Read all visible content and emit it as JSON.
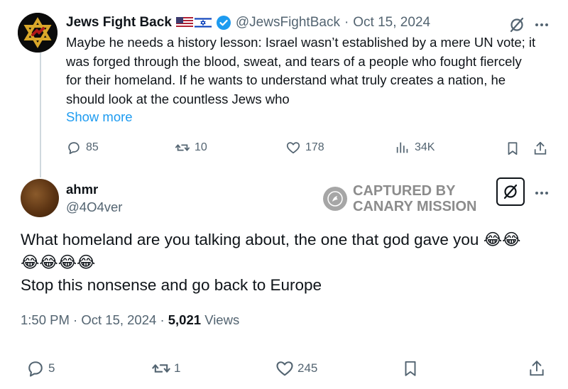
{
  "parent_tweet": {
    "author_name": "Jews Fight Back",
    "flags": [
      "flag-us-icon",
      "flag-israel-icon"
    ],
    "verified": "verified-badge-icon",
    "handle": "@JewsFightBack",
    "separator": "·",
    "date": "Oct 15, 2024",
    "body": "Maybe he needs a history lesson: Israel wasn’t established by a mere UN vote; it was forged through the blood, sweat, and tears of a people who fought fiercely for their homeland. If he wants to understand what truly creates a nation, he should look at the countless Jews who",
    "show_more": "Show more",
    "replies": "85",
    "reposts": "10",
    "likes": "178",
    "views": "34K"
  },
  "reply_tweet": {
    "author_name": "ahmr",
    "handle": "@4O4ver",
    "watermark_line1": "CAPTURED BY",
    "watermark_line2": "CANARY MISSION",
    "body_lines": [
      "What homeland are you talking about, the one that god gave you 😂😂",
      "😂😂😂😂",
      "Stop this nonsense and go back to Europe"
    ],
    "time": "1:50 PM",
    "separator": "·",
    "date": "Oct 15, 2024",
    "views_count": "5,021",
    "views_label": "Views",
    "replies": "5",
    "reposts": "1",
    "likes": "245"
  },
  "colors": {
    "link": "#1d9bf0",
    "verified": "#1d9bf0",
    "muted": "#536471",
    "watermark": "#8c8c8c"
  }
}
